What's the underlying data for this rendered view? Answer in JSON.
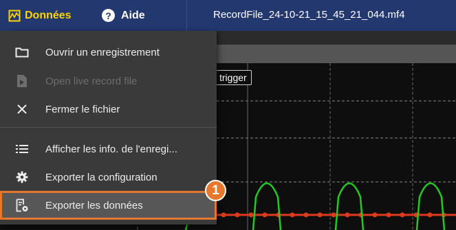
{
  "menubar": {
    "donnees_label": "Données",
    "aide_label": "Aide",
    "file_title": "RecordFile_24-10-21_15_45_21_044.mf4",
    "accent": "#ffd400",
    "background": "#23386e"
  },
  "plot": {
    "trigger_label": "trigger",
    "signal_color": "#22cc22",
    "marker_color": "#e03a1e"
  },
  "dropdown": {
    "items": [
      {
        "label": "Ouvrir un enregistrement",
        "icon": "folder-icon",
        "enabled": true
      },
      {
        "label": "Open live record file",
        "icon": "play-file-icon",
        "enabled": false
      },
      {
        "label": "Fermer le fichier",
        "icon": "close-icon",
        "enabled": true
      },
      {
        "label": "Afficher les info. de l'enregi...",
        "icon": "list-icon",
        "enabled": true
      },
      {
        "label": "Exporter la configuration",
        "icon": "gear-icon",
        "enabled": true
      },
      {
        "label": "Exporter les données",
        "icon": "export-data-icon",
        "enabled": true,
        "highlighted": true
      }
    ]
  },
  "annotation": {
    "step_number": "1",
    "color": "#e8772e"
  }
}
